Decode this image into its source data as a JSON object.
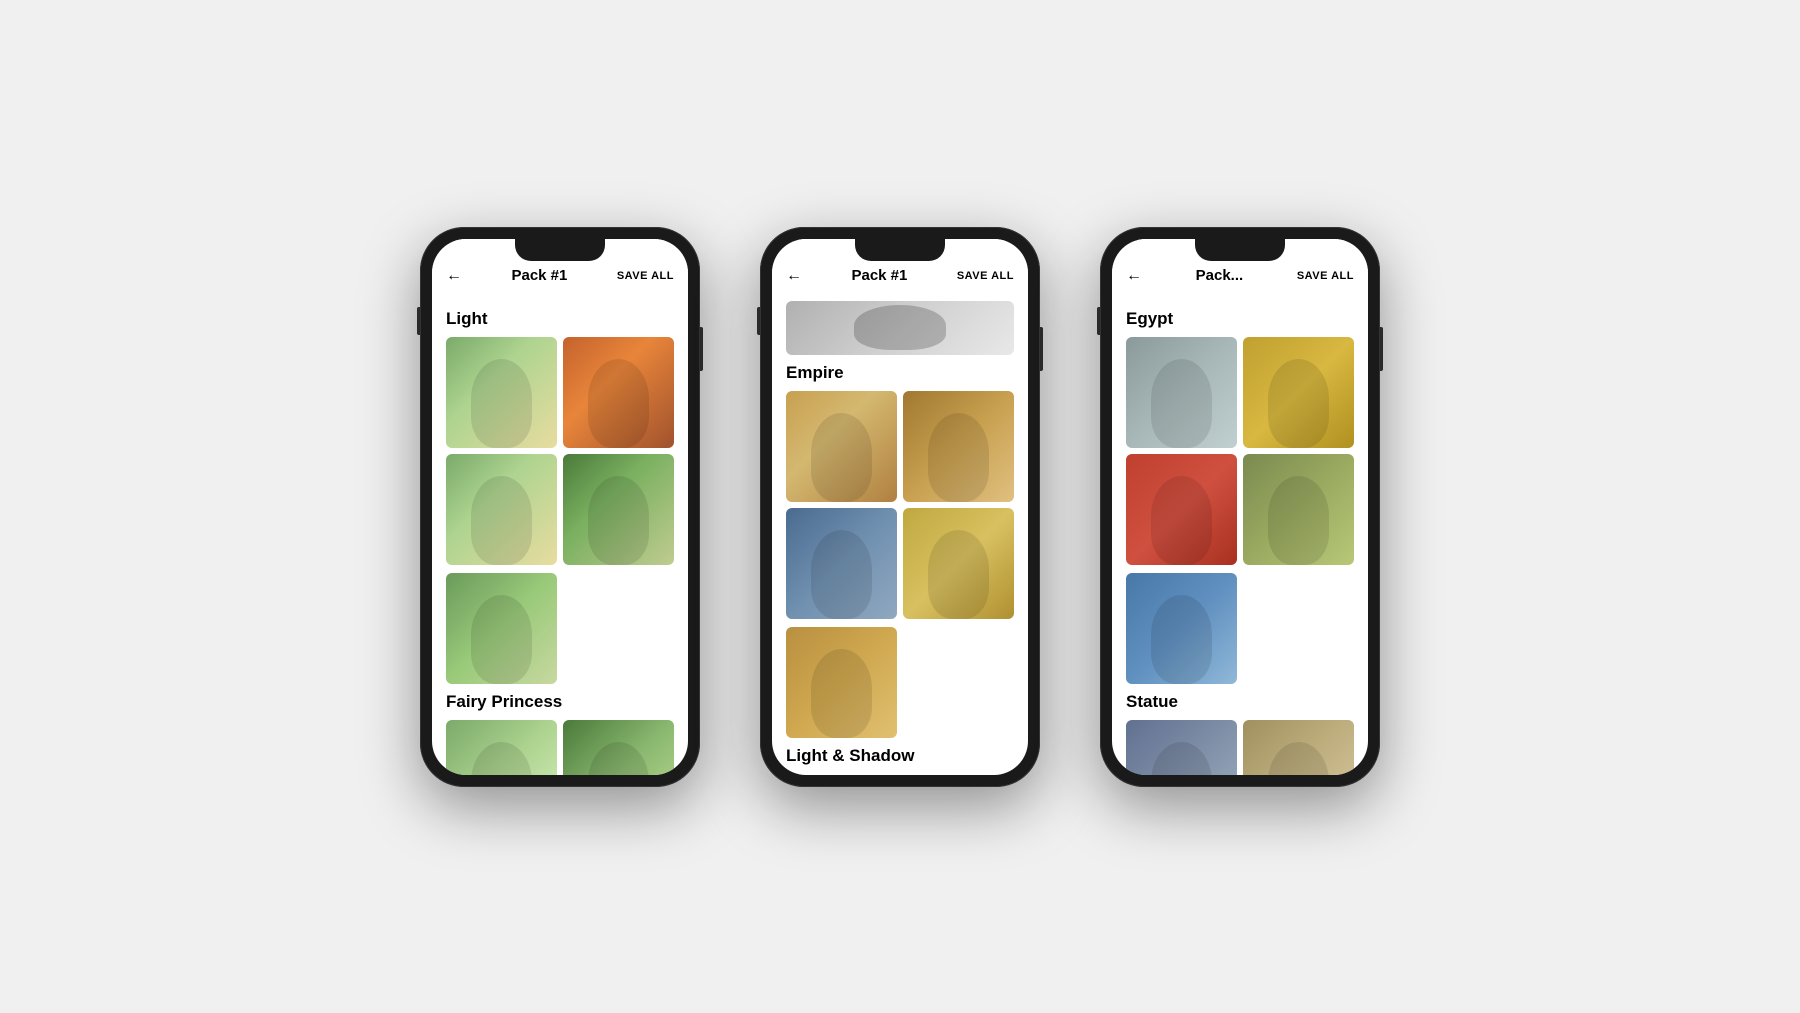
{
  "phones": [
    {
      "id": "phone1",
      "header": {
        "back": "←",
        "title": "Pack #1",
        "save_all": "SAVE ALL"
      },
      "sections": [
        {
          "title": "Light",
          "images": [
            {
              "id": "light-1",
              "color": "c-garden",
              "label": "Woman in garden"
            },
            {
              "id": "light-2",
              "color": "c-autumn",
              "label": "Woman autumn portrait"
            },
            {
              "id": "light-3",
              "color": "c-garden",
              "label": "Woman meadow"
            },
            {
              "id": "light-4",
              "color": "c-forest2",
              "label": "Woman forest"
            },
            {
              "id": "light-5",
              "color": "c-meadow",
              "label": "Woman seated meadow",
              "full_width": true
            }
          ]
        },
        {
          "title": "Fairy Princess",
          "images": [
            {
              "id": "fairy-1",
              "color": "c-fairy1",
              "label": "Fairy princess forest"
            },
            {
              "id": "fairy-2",
              "color": "c-fairy2",
              "label": "Fairy princess 2"
            }
          ]
        }
      ]
    },
    {
      "id": "phone2",
      "header": {
        "back": "←",
        "title": "Pack #1",
        "save_all": "SAVE ALL"
      },
      "partial_top": {
        "color": "c-gray",
        "label": "Partial top image"
      },
      "sections": [
        {
          "title": "Empire",
          "images": [
            {
              "id": "empire-1",
              "color": "c-empire1",
              "label": "Empire portrait 1"
            },
            {
              "id": "empire-2",
              "color": "c-empire2",
              "label": "Empire portrait 2"
            },
            {
              "id": "empire-3",
              "color": "c-empire3",
              "label": "Empire portrait 3"
            },
            {
              "id": "empire-4",
              "color": "c-empire4",
              "label": "Empire portrait 4"
            },
            {
              "id": "empire-5",
              "color": "c-empire5",
              "label": "Empire portrait 5",
              "full_width": true
            }
          ]
        },
        {
          "title": "Light & Shadow",
          "images": []
        }
      ]
    },
    {
      "id": "phone3",
      "header": {
        "back": "←",
        "title": "Pack...",
        "save_all": "SAVE ALL"
      },
      "sections": [
        {
          "title": "Egypt",
          "images": [
            {
              "id": "egypt-1",
              "color": "c-egypt1",
              "label": "Egypt portrait 1"
            },
            {
              "id": "egypt-2",
              "color": "c-egypt2",
              "label": "Egypt portrait 2"
            },
            {
              "id": "egypt-3",
              "color": "c-egypt3",
              "label": "Egypt portrait 3"
            },
            {
              "id": "egypt-4",
              "color": "c-egypt4",
              "label": "Egypt portrait 4"
            },
            {
              "id": "egypt-5",
              "color": "c-egypt5",
              "label": "Egypt portrait 5",
              "full_width": true
            }
          ]
        },
        {
          "title": "Statue",
          "images": [
            {
              "id": "statue-1",
              "color": "c-statue1",
              "label": "Statue portrait 1"
            },
            {
              "id": "statue-2",
              "color": "c-statue2",
              "label": "Statue portrait 2"
            }
          ]
        }
      ]
    }
  ]
}
